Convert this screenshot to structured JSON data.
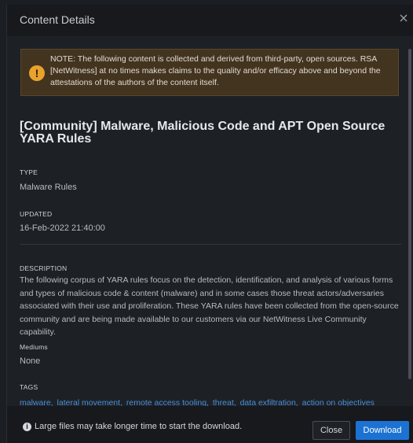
{
  "dialog": {
    "title": "Content Details",
    "close_icon": "close-icon"
  },
  "notice": {
    "icon": "warning-icon",
    "icon_glyph": "!",
    "text": "NOTE: The following content is collected and derived from third-party, open sources. RSA [NetWitness] at no times makes claims to the quality and/or efficacy above and beyond the attestations of the authors of the content itself."
  },
  "content": {
    "title": "[Community] Malware, Malicious Code and APT Open Source YARA Rules",
    "type_label": "TYPE",
    "type_value": "Malware Rules",
    "updated_label": "UPDATED",
    "updated_value": "16-Feb-2022 21:40:00",
    "description_label": "DESCRIPTION",
    "description": "The following corpus of YARA rules focus on the detection, identification, and analysis of various forms and types of malicious code & content (malware) and in some cases those threat actors/adversaries associated with their use and proliferation. These YARA rules have been collected from the open-source community and are being made available to our customers via our NetWitness Live Community capability.",
    "mediums_label": "Mediums",
    "mediums_value": "None",
    "tags_label": "TAGS",
    "tags": [
      "malware,",
      "lateral movement,",
      "remote access tooling,",
      "threat,",
      "data exfiltration,",
      "action on objectives"
    ]
  },
  "footer": {
    "info_icon": "info-icon",
    "info_glyph": "i",
    "info_text": "Large files may take longer time to start the download.",
    "close_label": "Close",
    "download_label": "Download"
  },
  "colors": {
    "accent": "#1c72d3",
    "warning": "#e8a22d",
    "tag_link": "#4a8ed8",
    "background": "#1d2126"
  }
}
